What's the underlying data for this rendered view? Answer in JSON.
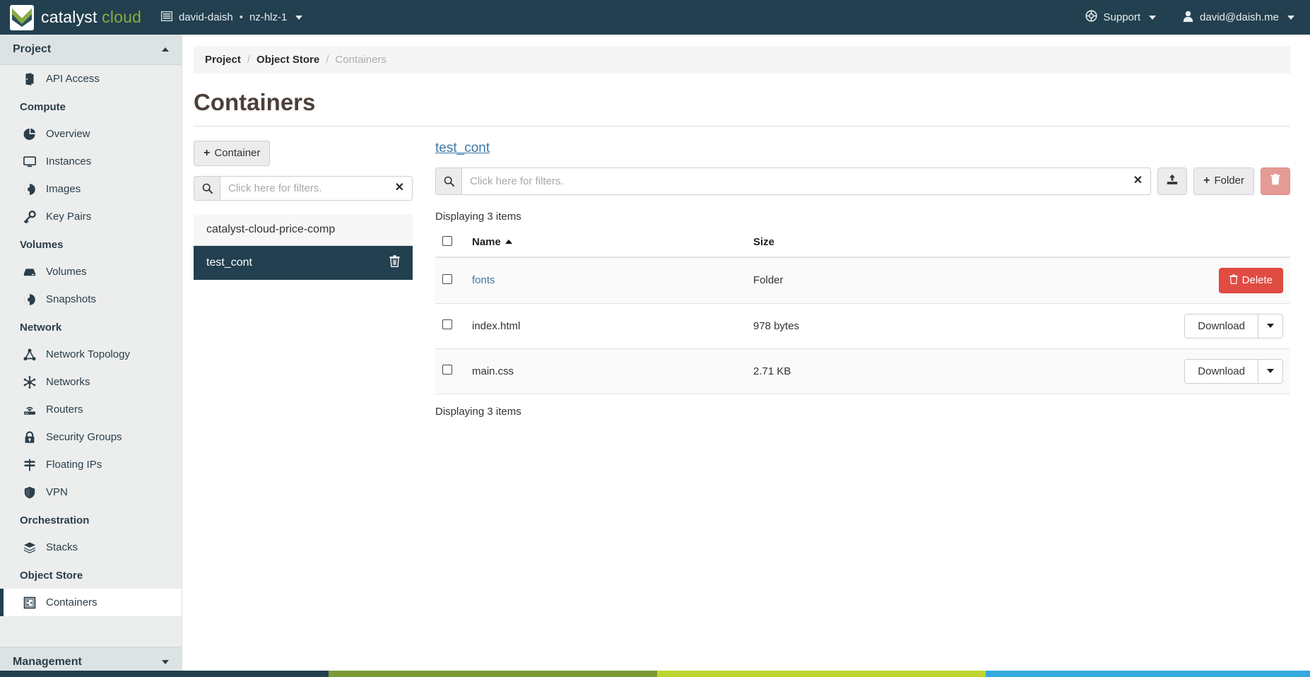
{
  "header": {
    "brand_part1": "catalyst",
    "brand_part2": "cloud",
    "logo_icon": "catalyst-check-logo-icon",
    "context": {
      "project_icon": "project-grid-icon",
      "project": "david-daish",
      "separator": "•",
      "region": "nz-hlz-1",
      "caret_icon": "chevron-down-icon"
    },
    "support": {
      "icon": "lifebuoy-icon",
      "label": "Support",
      "caret_icon": "chevron-down-icon"
    },
    "user": {
      "icon": "user-icon",
      "label": "david@daish.me",
      "caret_icon": "chevron-down-icon"
    }
  },
  "sidebar": {
    "panel_title": "Project",
    "panel_caret_icon": "chevron-up-icon",
    "footer_panel_title": "Management",
    "footer_panel_caret_icon": "chevron-down-icon",
    "sections": [
      {
        "label": "",
        "items": [
          {
            "label": "API Access",
            "icon": "door-icon",
            "active": false
          }
        ]
      },
      {
        "label": "Compute",
        "items": [
          {
            "label": "Overview",
            "icon": "pie-chart-icon",
            "active": false
          },
          {
            "label": "Instances",
            "icon": "monitor-icon",
            "active": false
          },
          {
            "label": "Images",
            "icon": "image-disc-icon",
            "active": false
          },
          {
            "label": "Key Pairs",
            "icon": "key-icon",
            "active": false
          }
        ]
      },
      {
        "label": "Volumes",
        "items": [
          {
            "label": "Volumes",
            "icon": "drive-icon",
            "active": false
          },
          {
            "label": "Snapshots",
            "icon": "snapshot-disc-icon",
            "active": false
          }
        ]
      },
      {
        "label": "Network",
        "items": [
          {
            "label": "Network Topology",
            "icon": "topology-icon",
            "active": false
          },
          {
            "label": "Networks",
            "icon": "network-nodes-icon",
            "active": false
          },
          {
            "label": "Routers",
            "icon": "router-icon",
            "active": false
          },
          {
            "label": "Security Groups",
            "icon": "lock-icon",
            "active": false
          },
          {
            "label": "Floating IPs",
            "icon": "signpost-icon",
            "active": false
          },
          {
            "label": "VPN",
            "icon": "shield-icon",
            "active": false
          }
        ]
      },
      {
        "label": "Orchestration",
        "items": [
          {
            "label": "Stacks",
            "icon": "layers-icon",
            "active": false
          }
        ]
      },
      {
        "label": "Object Store",
        "items": [
          {
            "label": "Containers",
            "icon": "container-box-icon",
            "active": true
          }
        ]
      }
    ]
  },
  "breadcrumb": {
    "items": [
      "Project",
      "Object Store"
    ],
    "current": "Containers",
    "separator": "/"
  },
  "page": {
    "title": "Containers"
  },
  "containers_panel": {
    "create_button": {
      "label": "Container",
      "icon": "plus-icon"
    },
    "filter": {
      "icon": "search-icon",
      "placeholder": "Click here for filters.",
      "value": "",
      "clear_icon": "close-x-icon"
    },
    "items": [
      {
        "name": "catalyst-cloud-price-comp",
        "selected": false,
        "delete_icon": "trash-icon"
      },
      {
        "name": "test_cont",
        "selected": true,
        "delete_icon": "trash-icon"
      }
    ]
  },
  "objects_panel": {
    "container_name": "test_cont",
    "filter": {
      "icon": "search-icon",
      "placeholder": "Click here for filters.",
      "value": "",
      "clear_icon": "close-x-icon"
    },
    "upload_button": {
      "icon": "upload-icon",
      "label": ""
    },
    "folder_button": {
      "icon": "plus-icon",
      "label": "Folder"
    },
    "delete_button": {
      "icon": "trash-icon",
      "label": ""
    },
    "count_top": "Displaying 3 items",
    "count_bottom": "Displaying 3 items",
    "table": {
      "select_all_checkbox": "checkbox",
      "columns": [
        {
          "label": "Name",
          "sort": "asc",
          "sort_icon": "caret-up-icon"
        },
        {
          "label": "Size",
          "sort": "none"
        }
      ],
      "rows": [
        {
          "checkbox": "checkbox",
          "name": "fonts",
          "is_link": true,
          "size": "Folder",
          "action": {
            "type": "delete",
            "label": "Delete",
            "icon": "trash-icon"
          }
        },
        {
          "checkbox": "checkbox",
          "name": "index.html",
          "is_link": false,
          "size": "978 bytes",
          "action": {
            "type": "split",
            "label": "Download",
            "caret_icon": "caret-down-icon"
          }
        },
        {
          "checkbox": "checkbox",
          "name": "main.css",
          "is_link": false,
          "size": "2.71 KB",
          "action": {
            "type": "split",
            "label": "Download",
            "caret_icon": "caret-down-icon"
          }
        }
      ]
    }
  },
  "colors": {
    "nav_dark": "#22404f",
    "brand_green": "#8aab3f",
    "link_blue": "#3b78a8",
    "danger_red": "#e04b42",
    "danger_muted": "#e69a96",
    "footer_stripe": [
      "#22404f",
      "#7a9a35",
      "#bed62f",
      "#34a9dd"
    ]
  }
}
